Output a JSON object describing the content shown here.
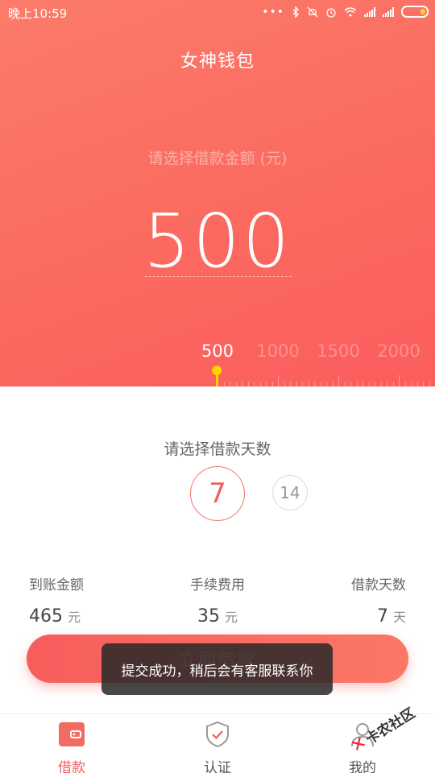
{
  "status": {
    "time": "晚上10:59",
    "dots": "•••",
    "icons": [
      "bluetooth-icon",
      "mute-icon",
      "alarm-icon",
      "wifi-icon",
      "signal-icon",
      "signal-icon",
      "battery-icon"
    ]
  },
  "app": {
    "title": "女神钱包"
  },
  "amount": {
    "label": "请选择借款金额 (元)",
    "value": "500",
    "ticks": [
      "500",
      "1000",
      "1500",
      "2000"
    ],
    "selected": "500"
  },
  "days": {
    "label": "请选择借款天数",
    "options": [
      "7",
      "14"
    ],
    "selected": "7"
  },
  "summary": {
    "received": {
      "label": "到账金额",
      "value": "465",
      "unit": "元"
    },
    "fee": {
      "label": "手续费用",
      "value": "35",
      "unit": "元"
    },
    "term": {
      "label": "借款天数",
      "value": "7",
      "unit": "天"
    }
  },
  "cta": {
    "label": "立即借款"
  },
  "toast": {
    "message": "提交成功，稍后会有客服联系你"
  },
  "nav": {
    "items": [
      {
        "label": "借款",
        "icon": "wallet-icon",
        "active": true
      },
      {
        "label": "认证",
        "icon": "shield-check-icon",
        "active": false
      },
      {
        "label": "我的",
        "icon": "user-icon",
        "active": false
      }
    ]
  },
  "watermark": {
    "text": "卡农社区"
  },
  "colors": {
    "accent": "#f0605d",
    "slider": "#ffd400",
    "hero": "#fb6a60"
  }
}
